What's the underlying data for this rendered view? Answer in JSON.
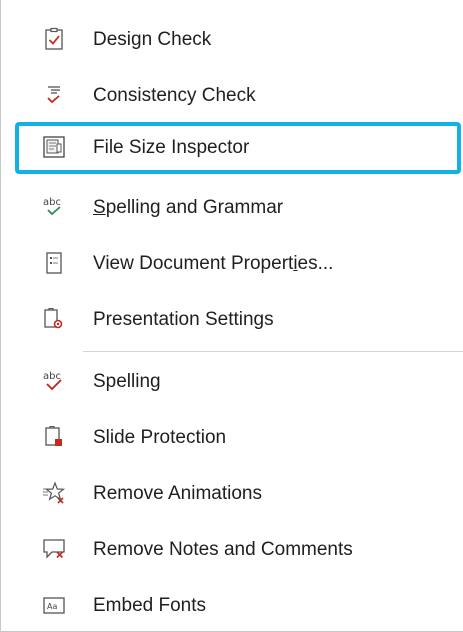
{
  "menu": {
    "items": [
      {
        "label": "Design Check",
        "icon": "design-check-icon"
      },
      {
        "label": "Consistency Check",
        "icon": "consistency-check-icon"
      },
      {
        "label": "File Size Inspector",
        "icon": "file-size-inspector-icon",
        "highlighted": true
      },
      {
        "label_accel": "S",
        "label_rest": "pelling and Grammar",
        "icon": "spelling-grammar-icon"
      },
      {
        "label_pre": "View Document Propert",
        "label_accel": "i",
        "label_post": "es...",
        "icon": "document-properties-icon"
      },
      {
        "label": "Presentation Settings",
        "icon": "presentation-settings-icon"
      },
      {
        "label": "Spelling",
        "icon": "spelling-icon"
      },
      {
        "label": "Slide Protection",
        "icon": "slide-protection-icon"
      },
      {
        "label": "Remove Animations",
        "icon": "remove-animations-icon"
      },
      {
        "label": "Remove Notes and Comments",
        "icon": "remove-comments-icon"
      },
      {
        "label": "Embed Fonts",
        "icon": "embed-fonts-icon"
      }
    ],
    "icon_text": {
      "abc": "abc",
      "font_sample": "Aa"
    },
    "colors": {
      "highlight_border": "#11b1e3",
      "check_red": "#c42b1c",
      "check_green": "#2e8b57",
      "separator": "#d4d4d4"
    }
  }
}
